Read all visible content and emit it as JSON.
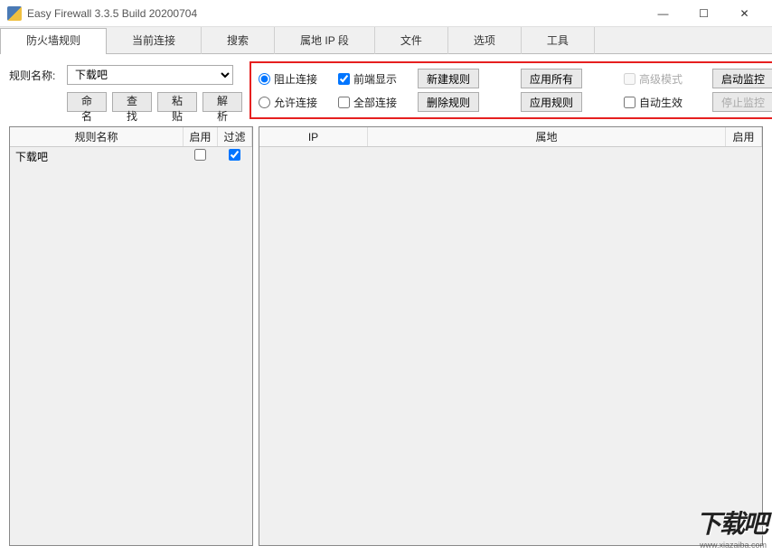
{
  "window": {
    "title": "Easy Firewall 3.3.5 Build 20200704"
  },
  "tabs": [
    {
      "label": "防火墙规则",
      "active": true
    },
    {
      "label": "当前连接",
      "active": false
    },
    {
      "label": "搜索",
      "active": false
    },
    {
      "label": "属地 IP 段",
      "active": false
    },
    {
      "label": "文件",
      "active": false
    },
    {
      "label": "选项",
      "active": false
    },
    {
      "label": "工具",
      "active": false
    }
  ],
  "controls": {
    "rule_name_label": "规则名称:",
    "rule_name_value": "下载吧",
    "btn_rename": "命名",
    "btn_find": "查找",
    "btn_paste": "粘贴",
    "btn_parse": "解析"
  },
  "options": {
    "radio_block": "阻止连接",
    "radio_allow": "允许连接",
    "chk_front_display": "前端显示",
    "chk_all_connect": "全部连接",
    "btn_new_rule": "新建规则",
    "btn_delete_rule": "删除规则",
    "btn_apply_all": "应用所有",
    "btn_apply_rule": "应用规则",
    "chk_advanced": "高级模式",
    "chk_auto_effect": "自动生效",
    "btn_start_monitor": "启动监控",
    "btn_stop_monitor": "停止监控",
    "radio_selected": "block",
    "chk_front_display_checked": true,
    "chk_all_connect_checked": false,
    "chk_advanced_checked": false,
    "chk_auto_effect_checked": false
  },
  "left_table": {
    "columns": {
      "rule_name": "规则名称",
      "enable": "启用",
      "filter": "过滤"
    },
    "rows": [
      {
        "name": "下载吧",
        "enabled": false,
        "filtered": true
      }
    ]
  },
  "right_table": {
    "columns": {
      "ip": "IP",
      "location": "属地",
      "enable": "启用"
    },
    "rows": []
  },
  "watermark": {
    "big": "下载吧",
    "small": "www.xiazaiba.com"
  }
}
